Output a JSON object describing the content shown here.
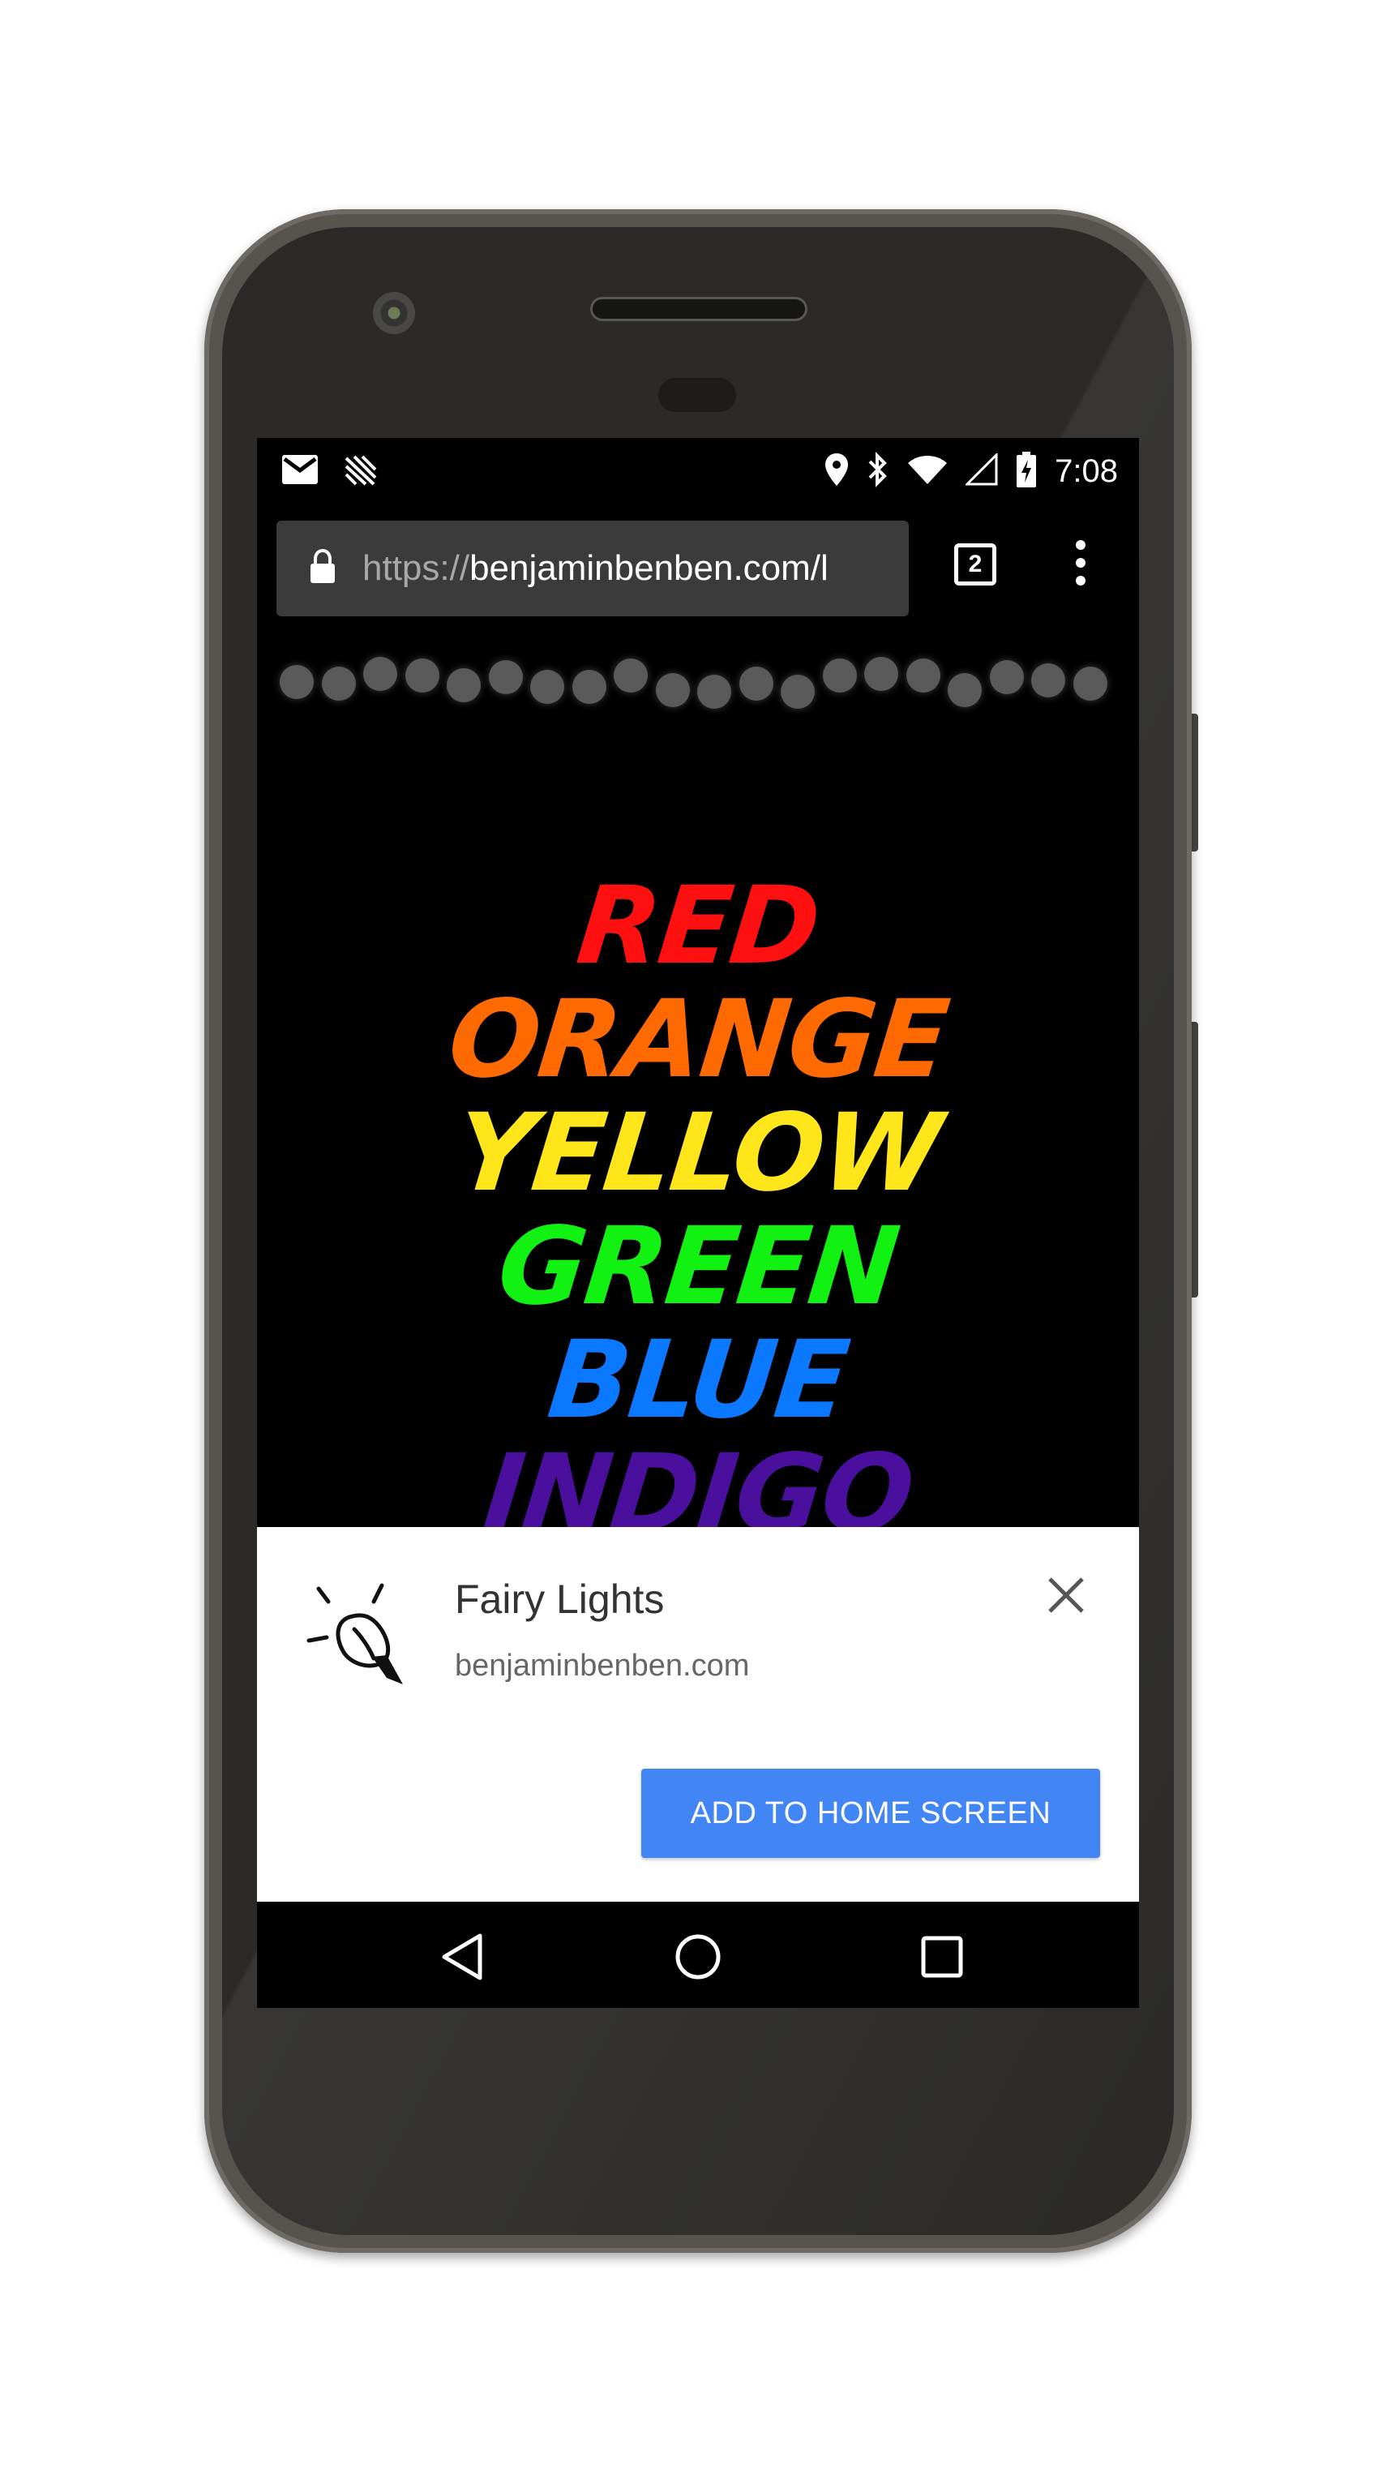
{
  "status_bar": {
    "time": "7:08",
    "icons_left": [
      "gmail-icon",
      "cast-icon"
    ],
    "icons_right": [
      "location-icon",
      "bluetooth-icon",
      "wifi-icon",
      "signal-icon",
      "battery-charging-icon"
    ]
  },
  "browser": {
    "url_scheme": "https://",
    "url_host": "benjaminbenben.com/l",
    "tab_count": "2"
  },
  "page": {
    "background": "#000000",
    "colors": [
      "RED",
      "ORANGE",
      "YELLOW",
      "GREEN",
      "BLUE",
      "INDIGO"
    ],
    "color_values": {
      "RED": "#ff1010",
      "ORANGE": "#ff6a00",
      "YELLOW": "#ffe61a",
      "GREEN": "#12f212",
      "BLUE": "#0a78ff",
      "INDIGO": "#4b0f9e"
    }
  },
  "banner": {
    "app_name": "Fairy Lights",
    "app_url": "benjaminbenben.com",
    "add_button_label": "ADD TO HOME SCREEN",
    "accent": "#4285f4"
  },
  "nav": {
    "buttons": [
      "back-icon",
      "home-icon",
      "recents-icon"
    ]
  }
}
